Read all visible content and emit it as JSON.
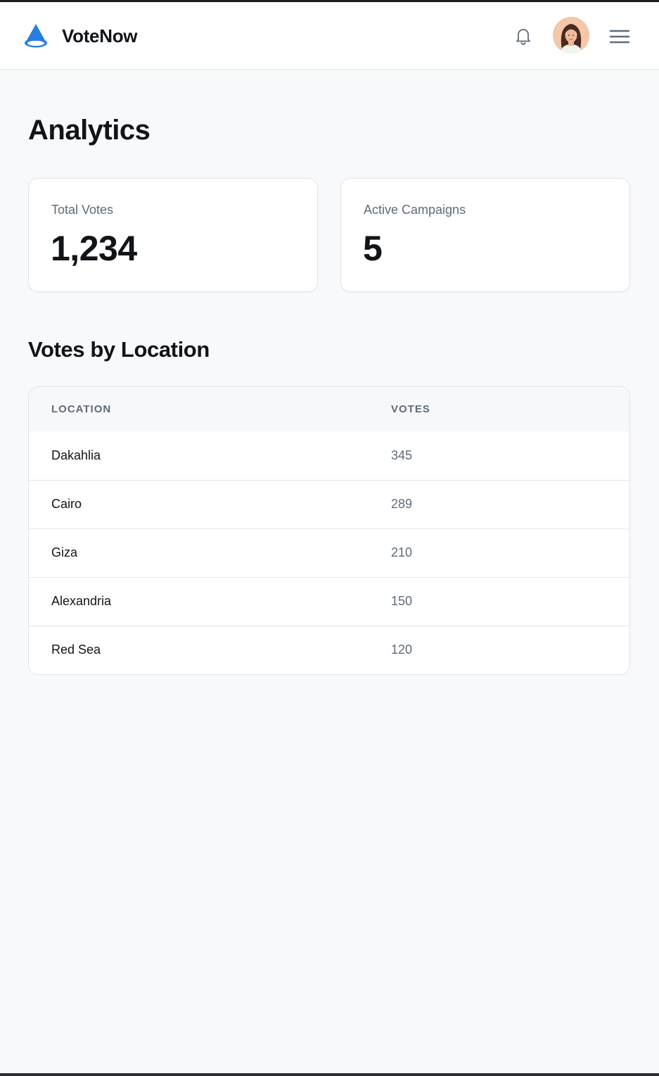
{
  "app": {
    "name": "VoteNow"
  },
  "header": {
    "icons": {
      "logo": "cone-logo-icon",
      "notifications": "bell-icon",
      "menu": "hamburger-menu-icon"
    },
    "brand_color": "#2a7de1"
  },
  "page": {
    "title": "Analytics"
  },
  "stats": [
    {
      "label": "Total Votes",
      "value": "1,234"
    },
    {
      "label": "Active Campaigns",
      "value": "5"
    }
  ],
  "votes_by_location": {
    "title": "Votes by Location",
    "columns": [
      "LOCATION",
      "VOTES"
    ],
    "rows": [
      {
        "location": "Dakahlia",
        "votes": "345"
      },
      {
        "location": "Cairo",
        "votes": "289"
      },
      {
        "location": "Giza",
        "votes": "210"
      },
      {
        "location": "Alexandria",
        "votes": "150"
      },
      {
        "location": "Red Sea",
        "votes": "120"
      }
    ]
  }
}
